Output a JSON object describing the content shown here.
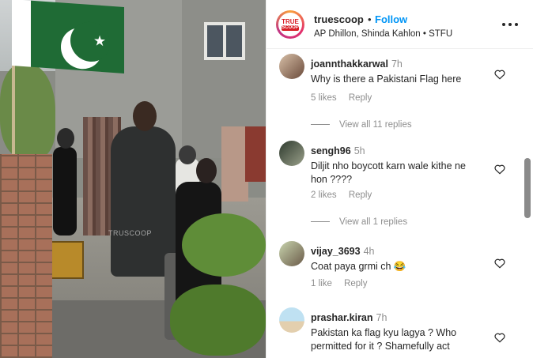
{
  "post": {
    "account": "truescoop",
    "separator": "•",
    "follow_label": "Follow",
    "audio": "AP Dhillon, Shinda Kahlon • STFU",
    "logo_top": "TRUE",
    "logo_bottom": "SCOOP",
    "more_icon": "more-horizontal-icon"
  },
  "media": {
    "watermark": "TRUSCOOP"
  },
  "comments": [
    {
      "username": "joannthakkarwal",
      "time": "7h",
      "text": "Why is there a Pakistani Flag here",
      "likes": "5 likes",
      "reply_label": "Reply",
      "view_replies": "View all 11 replies"
    },
    {
      "username": "sengh96",
      "time": "5h",
      "text": "Diljit nho boycott karn wale kithe ne hon ????",
      "likes": "2 likes",
      "reply_label": "Reply",
      "view_replies": "View all 1 replies"
    },
    {
      "username": "vijay_3693",
      "time": "4h",
      "text": "Coat paya grmi ch 😂",
      "likes": "1 like",
      "reply_label": "Reply",
      "view_replies": ""
    },
    {
      "username": "prashar.kiran",
      "time": "7h",
      "text": "Pakistan ka flag kyu lagya ? Who permitted for it ? Shamefully act",
      "likes": "",
      "reply_label": "",
      "view_replies": ""
    }
  ],
  "icons": {
    "heart": "heart-outline-icon"
  },
  "colors": {
    "follow": "#0095f6",
    "text": "#262626",
    "secondary": "#8e8e8e"
  }
}
